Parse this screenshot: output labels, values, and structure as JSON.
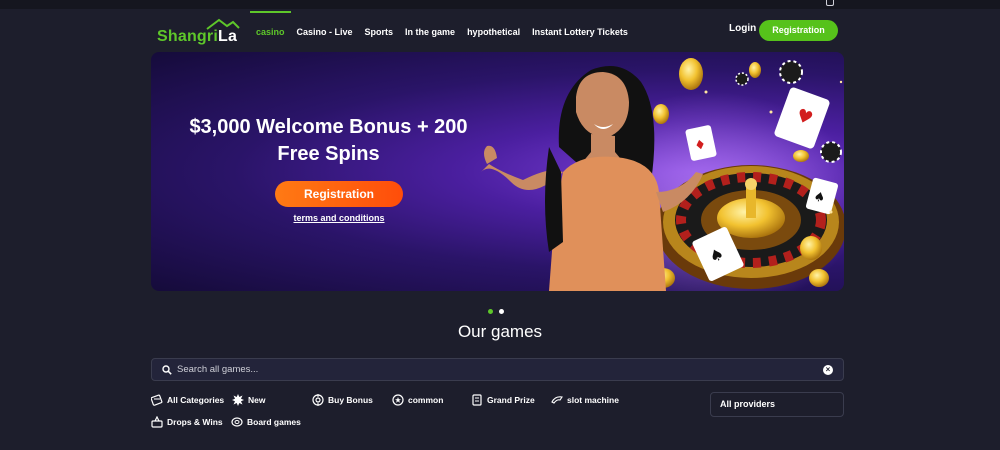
{
  "brand": {
    "name_part1": "Shangri",
    "name_part2": "La",
    "accent": "#5ec72a"
  },
  "nav": [
    {
      "label": "casino",
      "active": true
    },
    {
      "label": "Casino - Live"
    },
    {
      "label": "Sports"
    },
    {
      "label": "In the game"
    },
    {
      "label": "hypothetical"
    },
    {
      "label": "Instant Lottery Tickets"
    }
  ],
  "header": {
    "login_label": "Login",
    "register_label": "Registration"
  },
  "banner": {
    "title_line1": "$3,000 Welcome Bonus + 200",
    "title_line2": "Free Spins",
    "cta_label": "Registration",
    "terms_label": "terms and conditions"
  },
  "carousel": {
    "slides": 2,
    "active_index": 0
  },
  "games": {
    "heading": "Our games",
    "search_placeholder": "Search all games...",
    "categories": [
      {
        "label": "All Categories",
        "icon": "grid-icon"
      },
      {
        "label": "New",
        "icon": "starburst-icon"
      },
      {
        "label": "Buy Bonus",
        "icon": "target-icon"
      },
      {
        "label": "common",
        "icon": "star-circle-icon"
      },
      {
        "label": "Grand Prize",
        "icon": "trophy-icon"
      },
      {
        "label": "slot machine",
        "icon": "slot-icon"
      },
      {
        "label": "Drops & Wins",
        "icon": "drops-icon"
      },
      {
        "label": "Board games",
        "icon": "board-icon"
      }
    ],
    "providers_label": "All providers"
  }
}
